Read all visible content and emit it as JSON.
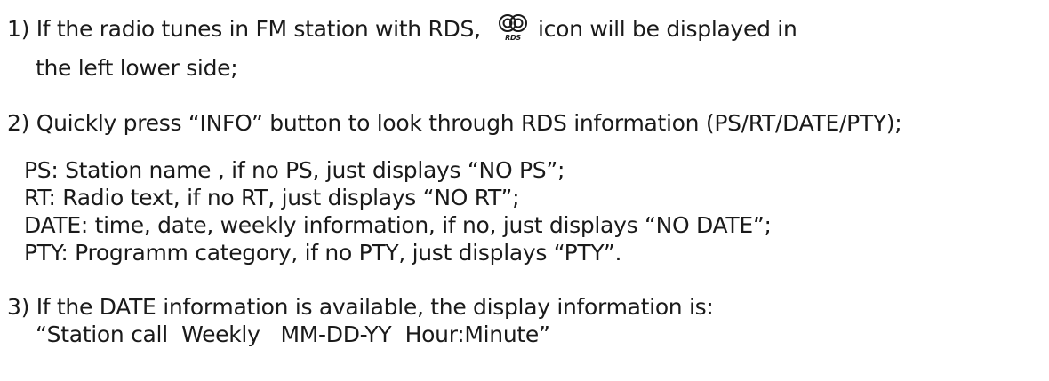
{
  "sections": {
    "s1": {
      "line1_before_icon": "1) If the radio tunes in FM station with RDS, ",
      "icon": "rds-icon",
      "icon_text": "RDS",
      "line1_after_icon": " icon will be displayed in",
      "line2": "the left lower side;"
    },
    "s2": {
      "heading": "2) Quickly press “INFO” button to look through RDS information (PS/RT/DATE/PTY);",
      "items": [
        "PS: Station name , if no PS, just displays “NO PS”;",
        "RT: Radio text, if no RT, just displays “NO RT”;",
        "DATE: time, date, weekly information, if no, just displays “NO DATE”;",
        "PTY: Programm category, if no PTY, just displays “PTY”."
      ]
    },
    "s3": {
      "line1": "3) If the DATE information is available, the display information is:",
      "line2": "“Station call  Weekly   MM-DD-YY  Hour:Minute”"
    }
  }
}
